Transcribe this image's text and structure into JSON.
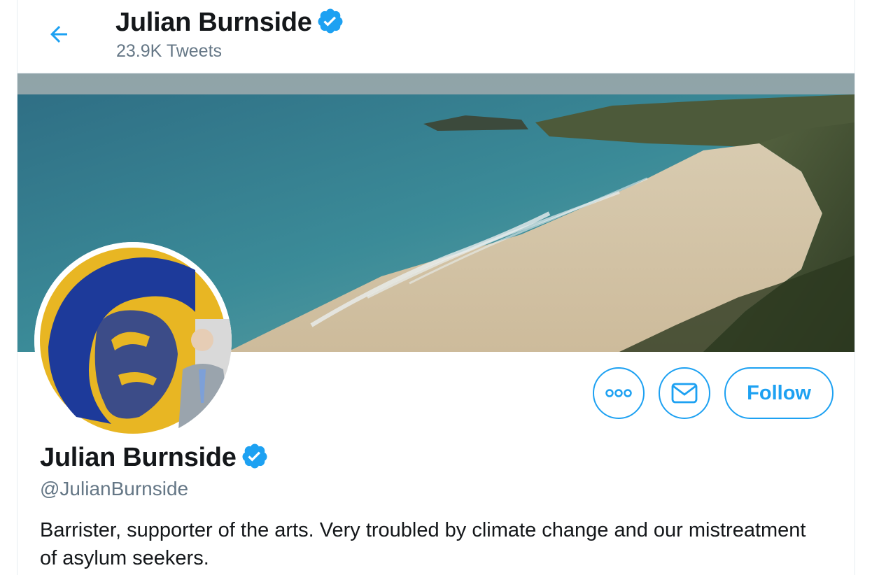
{
  "header": {
    "back_icon": "arrow-left-icon",
    "name": "Julian Burnside",
    "tweet_count": "23.9K Tweets",
    "verified_icon": "verified-badge-icon"
  },
  "banner": {
    "description": "coastal beach landscape photo"
  },
  "actions": {
    "more_icon": "more-options-icon",
    "message_icon": "envelope-icon",
    "follow_label": "Follow"
  },
  "profile": {
    "name": "Julian Burnside",
    "handle": "@JulianBurnside",
    "bio": "Barrister, supporter of the arts. Very troubled by climate change and our mistreatment of asylum seekers."
  },
  "colors": {
    "accent": "#1da1f2",
    "secondary_text": "#657786",
    "primary_text": "#14171a"
  }
}
